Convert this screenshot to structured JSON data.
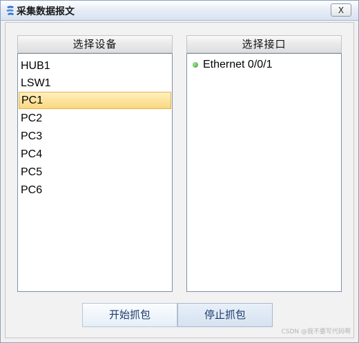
{
  "window": {
    "title": "采集数据报文",
    "close_label": "X"
  },
  "device_panel": {
    "header": "选择设备",
    "items": [
      "HUB1",
      "LSW1",
      "PC1",
      "PC2",
      "PC3",
      "PC4",
      "PC5",
      "PC6"
    ],
    "selected": "PC1"
  },
  "interface_panel": {
    "header": "选择接口",
    "items": [
      {
        "label": "Ethernet 0/0/1",
        "status_color": "#3cb52f"
      }
    ]
  },
  "buttons": {
    "start": "开始抓包",
    "stop": "停止抓包"
  },
  "watermark": "CSDN @我不要写代码啊",
  "colors": {
    "selection": "#f9d77f",
    "link_up": "#3cb52f"
  }
}
